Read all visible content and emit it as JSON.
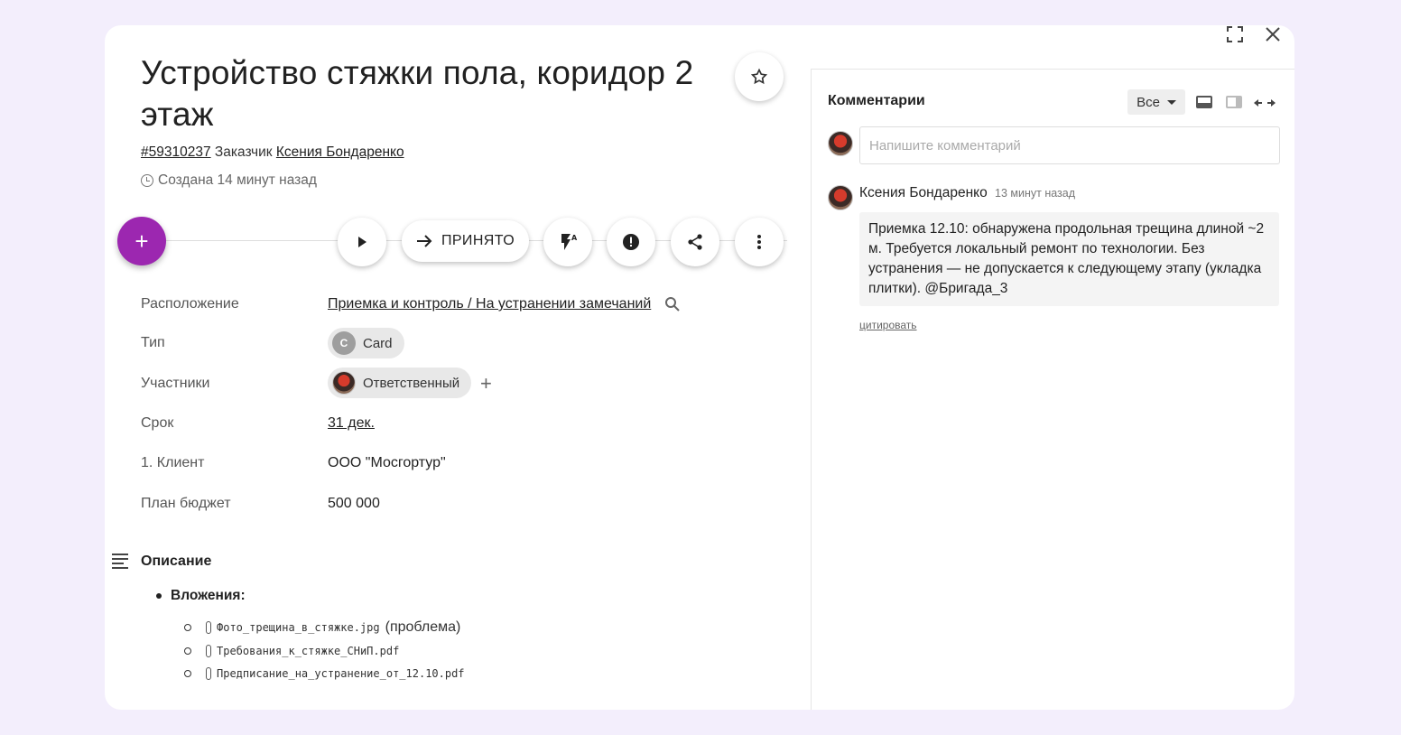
{
  "card": {
    "title": "Устройство стяжки пола, коридор 2 этаж",
    "id_link": "#59310237",
    "customer_label": "Заказчик",
    "customer_name": "Ксения Бондаренко",
    "created": "Создана 14 минут назад"
  },
  "actions": {
    "accept_label": "ПРИНЯТО"
  },
  "fields": {
    "location_label": "Расположение",
    "location_value": "Приемка и контроль / На устранении замечаний",
    "type_label": "Тип",
    "type_initial": "C",
    "type_value": "Card",
    "participants_label": "Участники",
    "participant_role": "Ответственный",
    "deadline_label": "Срок",
    "deadline_value": "31 дек.",
    "client_label": "1. Клиент",
    "client_value": "ООО \"Мосгортур\"",
    "budget_label": "План бюджет",
    "budget_value": "500 000"
  },
  "description": {
    "title": "Описание",
    "attachments_label": "Вложения:",
    "attachments": [
      {
        "file": "Фото_трещина_в_стяжке.jpg",
        "suffix": "(проблема)"
      },
      {
        "file": "Требования_к_стяжке_СНиП.pdf",
        "suffix": ""
      },
      {
        "file": "Предписание_на_устранение_от_12.10.pdf",
        "suffix": ""
      }
    ]
  },
  "comments": {
    "title": "Комментарии",
    "filter": "Все",
    "input_placeholder": "Напишите комментарий",
    "items": [
      {
        "author": "Ксения Бондаренко",
        "time": "13 минут назад",
        "text": "Приемка 12.10: обнаружена продольная трещина длиной ~2 м. Требуется локальный ремонт по технологии. Без устранения — не допускается к следующему этапу (укладка плитки). @Бригада_3",
        "quote_label": "цитировать"
      }
    ]
  },
  "colors": {
    "accent": "#9c27b0",
    "background": "#f3eefc"
  }
}
